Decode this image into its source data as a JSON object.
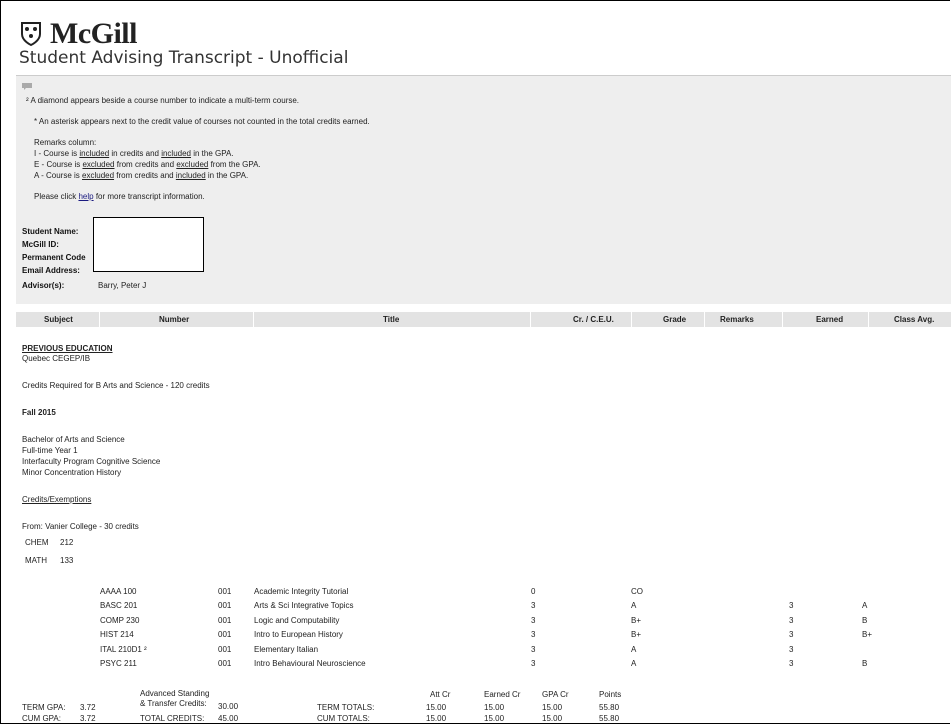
{
  "brand": {
    "name": "McGill"
  },
  "page": {
    "title": "Student Advising Transcript - Unofficial"
  },
  "info": {
    "diamond_note": "² A diamond appears beside a course number to indicate a multi-term course.",
    "asterisk_note": "* An asterisk appears next to the credit value of courses not counted in the total credits earned.",
    "remarks_heading": "Remarks column:",
    "remark_i": {
      "prefix": "I - Course is ",
      "w1": "included",
      "mid": " in credits and ",
      "w2": "included",
      "suffix": " in the GPA."
    },
    "remark_e": {
      "prefix": "E - Course is ",
      "w1": "excluded",
      "mid": " from credits and ",
      "w2": "excluded",
      "suffix": " from the GPA."
    },
    "remark_a": {
      "prefix": "A - Course is ",
      "w1": "excluded",
      "mid": " from credits and ",
      "w2": "included",
      "suffix": " in the GPA."
    },
    "help_prefix": "Please click ",
    "help_link": "help",
    "help_suffix": " for more transcript information."
  },
  "student": {
    "name_label": "Student Name:",
    "id_label": "McGill ID:",
    "code_label": "Permanent Code",
    "email_label": "Email Address:",
    "advisor_label": "Advisor(s):",
    "advisor_value": "Barry, Peter J"
  },
  "columns": [
    "Subject",
    "Number",
    "Title",
    "Cr. / C.E.U.",
    "Grade",
    "Remarks",
    "Earned",
    "Class Avg."
  ],
  "previous_education": {
    "heading": "PREVIOUS EDUCATION",
    "source": "Quebec CEGEP/IB",
    "credits_required": "Credits Required for B Arts and Science  -  120 credits"
  },
  "term": {
    "name": "Fall 2015",
    "program_lines": [
      "Bachelor of Arts and Science",
      "Full-time  Year 1",
      "Interfaculty Program Cognitive Science",
      "Minor Concentration History"
    ],
    "exemptions_heading": "Credits/Exemptions",
    "exemptions_from": "From: Vanier College - 30 credits",
    "exemptions": [
      {
        "subject": "CHEM",
        "number": "212"
      },
      {
        "subject": "MATH",
        "number": "133"
      }
    ]
  },
  "courses": [
    {
      "course": "AAAA 100",
      "section": "001",
      "title": "Academic Integrity Tutorial",
      "credits": "0",
      "grade": "CO",
      "earned": "",
      "class_avg": ""
    },
    {
      "course": "BASC 201",
      "section": "001",
      "title": "Arts & Sci Integrative Topics",
      "credits": "3",
      "grade": "A",
      "earned": "3",
      "class_avg": "A"
    },
    {
      "course": "COMP 230",
      "section": "001",
      "title": "Logic and Computability",
      "credits": "3",
      "grade": "B+",
      "earned": "3",
      "class_avg": "B"
    },
    {
      "course": "HIST 214",
      "section": "001",
      "title": "Intro to European History",
      "credits": "3",
      "grade": "B+",
      "earned": "3",
      "class_avg": "B+"
    },
    {
      "course": "ITAL 210D1 ²",
      "section": "001",
      "title": "Elementary Italian",
      "credits": "3",
      "grade": "A",
      "earned": "3",
      "class_avg": ""
    },
    {
      "course": "PSYC 211",
      "section": "001",
      "title": "Intro Behavioural Neuroscience",
      "credits": "3",
      "grade": "A",
      "earned": "3",
      "class_avg": "B"
    }
  ],
  "totals": {
    "term_gpa_label": "TERM GPA:",
    "term_gpa": "3.72",
    "cum_gpa_label": "CUM GPA:",
    "cum_gpa": "3.72",
    "adv_label_1": "Advanced Standing",
    "adv_label_2": "& Transfer Credits:",
    "adv_value": "30.00",
    "total_credits_label": "TOTAL CREDITS:",
    "total_credits": "45.00",
    "headers": [
      "Att Cr",
      "Earned Cr",
      "GPA Cr",
      "Points"
    ],
    "term_totals_label": "TERM TOTALS:",
    "term_totals": [
      "15.00",
      "15.00",
      "15.00",
      "55.80"
    ],
    "cum_totals_label": "CUM TOTALS:",
    "cum_totals": [
      "15.00",
      "15.00",
      "15.00",
      "55.80"
    ]
  }
}
